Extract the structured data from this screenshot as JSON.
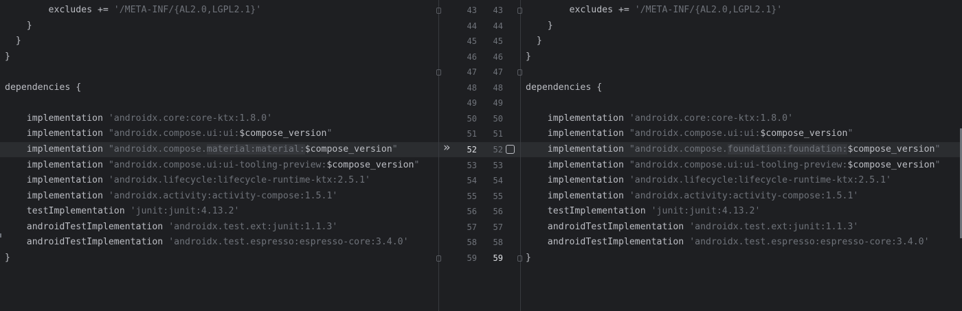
{
  "left_pane": {
    "lines": [
      {
        "code": "        excludes += '/META-INF/{AL2.0,LGPL2.1}'"
      },
      {
        "code": "    }"
      },
      {
        "code": "  }"
      },
      {
        "code": "}"
      },
      {
        "code": ""
      },
      {
        "code": "dependencies {"
      },
      {
        "code": ""
      },
      {
        "code": "    implementation 'androidx.core:core-ktx:1.8.0'"
      },
      {
        "code": "    implementation \"androidx.compose.ui:ui:$compose_version\""
      },
      {
        "pre": "    implementation \"androidx.compose.",
        "hl": "material:material:",
        "post": "$compose_version\""
      },
      {
        "code": "    implementation \"androidx.compose.ui:ui-tooling-preview:$compose_version\""
      },
      {
        "code": "    implementation 'androidx.lifecycle:lifecycle-runtime-ktx:2.5.1'"
      },
      {
        "code": "    implementation 'androidx.activity:activity-compose:1.5.1'"
      },
      {
        "code": "    testImplementation 'junit:junit:4.13.2'"
      },
      {
        "code": "    androidTestImplementation 'androidx.test.ext:junit:1.1.3'"
      },
      {
        "code": "    androidTestImplementation 'androidx.test.espresso:espresso-core:3.4.0'"
      },
      {
        "code": "}"
      }
    ]
  },
  "right_pane": {
    "lines": [
      {
        "code": "        excludes += '/META-INF/{AL2.0,LGPL2.1}'"
      },
      {
        "code": "    }"
      },
      {
        "code": "  }"
      },
      {
        "code": "}"
      },
      {
        "code": ""
      },
      {
        "code": "dependencies {"
      },
      {
        "code": ""
      },
      {
        "code": "    implementation 'androidx.core:core-ktx:1.8.0'"
      },
      {
        "code": "    implementation \"androidx.compose.ui:ui:$compose_version\""
      },
      {
        "pre": "    implementation \"androidx.compose.",
        "hl": "foundation:foundation:",
        "post": "$compose_version\""
      },
      {
        "code": "    implementation \"androidx.compose.ui:ui-tooling-preview:$compose_version\""
      },
      {
        "code": "    implementation 'androidx.lifecycle:lifecycle-runtime-ktx:2.5.1'"
      },
      {
        "code": "    implementation 'androidx.activity:activity-compose:1.5.1'"
      },
      {
        "code": "    testImplementation 'junit:junit:4.13.2'"
      },
      {
        "code": "    androidTestImplementation 'androidx.test.ext:junit:1.1.3'"
      },
      {
        "code": "    androidTestImplementation 'androidx.test.espresso:espresso-core:3.4.0'"
      },
      {
        "code": "}"
      }
    ]
  },
  "gutter": {
    "left_numbers": [
      "43",
      "44",
      "45",
      "46",
      "47",
      "48",
      "49",
      "50",
      "51",
      "52",
      "53",
      "54",
      "55",
      "56",
      "57",
      "58",
      "59"
    ],
    "right_numbers": [
      "43",
      "44",
      "45",
      "46",
      "47",
      "48",
      "49",
      "50",
      "51",
      "52",
      "53",
      "54",
      "55",
      "56",
      "57",
      "58",
      "59"
    ],
    "changed_row": 9,
    "active_right_row": 16,
    "apply_icon": "double-chevron-right-icon",
    "accept_icon": "checkbox-icon"
  },
  "colors": {
    "background": "#1e1f22",
    "changed_line": "#2b2d30",
    "text": "#bcbec4",
    "string": "#6f737a",
    "line_number": "#6f737a"
  }
}
